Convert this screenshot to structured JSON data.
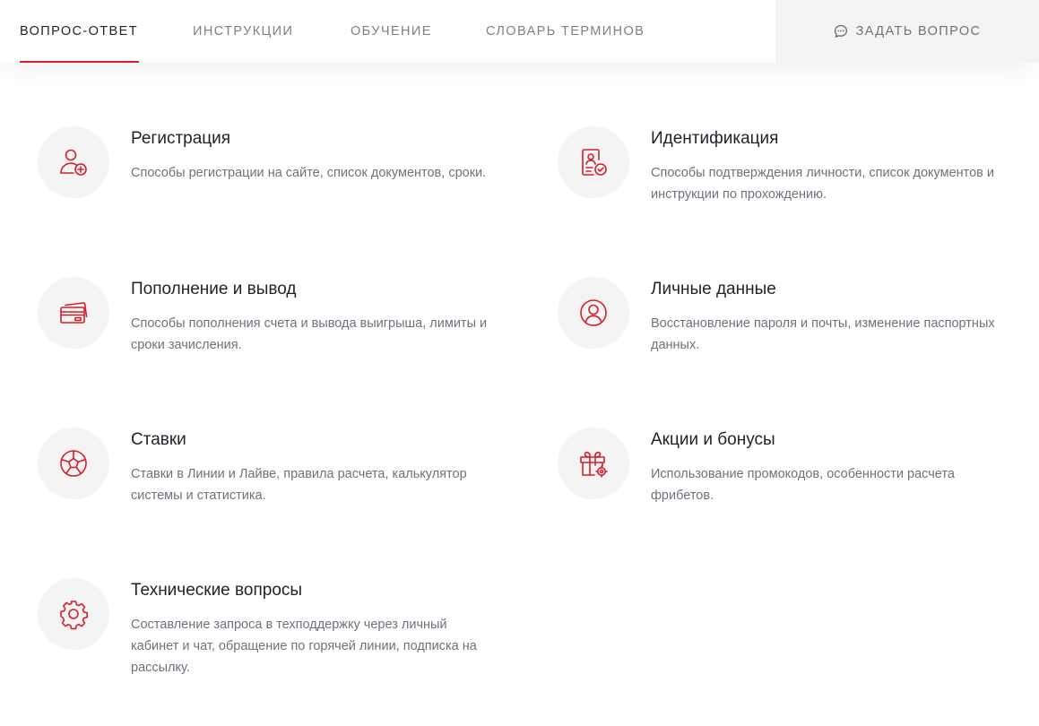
{
  "nav": {
    "tabs": [
      {
        "label": "ВОПРОС-ОТВЕТ",
        "active": true
      },
      {
        "label": "ИНСТРУКЦИИ",
        "active": false
      },
      {
        "label": "ОБУЧЕНИЕ",
        "active": false
      },
      {
        "label": "СЛОВАРЬ ТЕРМИНОВ",
        "active": false
      }
    ],
    "ask": {
      "label": "ЗАДАТЬ ВОПРОС",
      "icon": "chat-bubble-icon"
    }
  },
  "colors": {
    "accent": "#d4202a",
    "text": "#1f2329",
    "muted": "#6d737c",
    "icon_bg": "#f4f4f5"
  },
  "categories": [
    {
      "icon": "user-add-icon",
      "title": "Регистрация",
      "description": "Способы регистрации на сайте, список документов, сроки."
    },
    {
      "icon": "id-check-icon",
      "title": "Идентификация",
      "description": "Способы подтверждения личности, список документов и инструкции по прохождению."
    },
    {
      "icon": "wallet-card-icon",
      "title": "Пополнение и вывод",
      "description": "Способы пополнения счета и вывода выигрыша, лимиты и сроки зачисления."
    },
    {
      "icon": "profile-icon",
      "title": "Личные данные",
      "description": "Восстановление пароля и почты, изменение паспортных данных."
    },
    {
      "icon": "soccer-ball-icon",
      "title": "Ставки",
      "description": "Ставки в Линии и Лайве, правила расчета, калькулятор системы и статистика."
    },
    {
      "icon": "gift-icon",
      "title": "Акции и бонусы",
      "description": "Использование промокодов, особенности расчета фрибетов."
    },
    {
      "icon": "gear-icon",
      "title": "Технические вопросы",
      "description": "Составление запроса в техподдержку через личный кабинет и чат, обращение по горячей линии, подписка на рассылку."
    }
  ]
}
